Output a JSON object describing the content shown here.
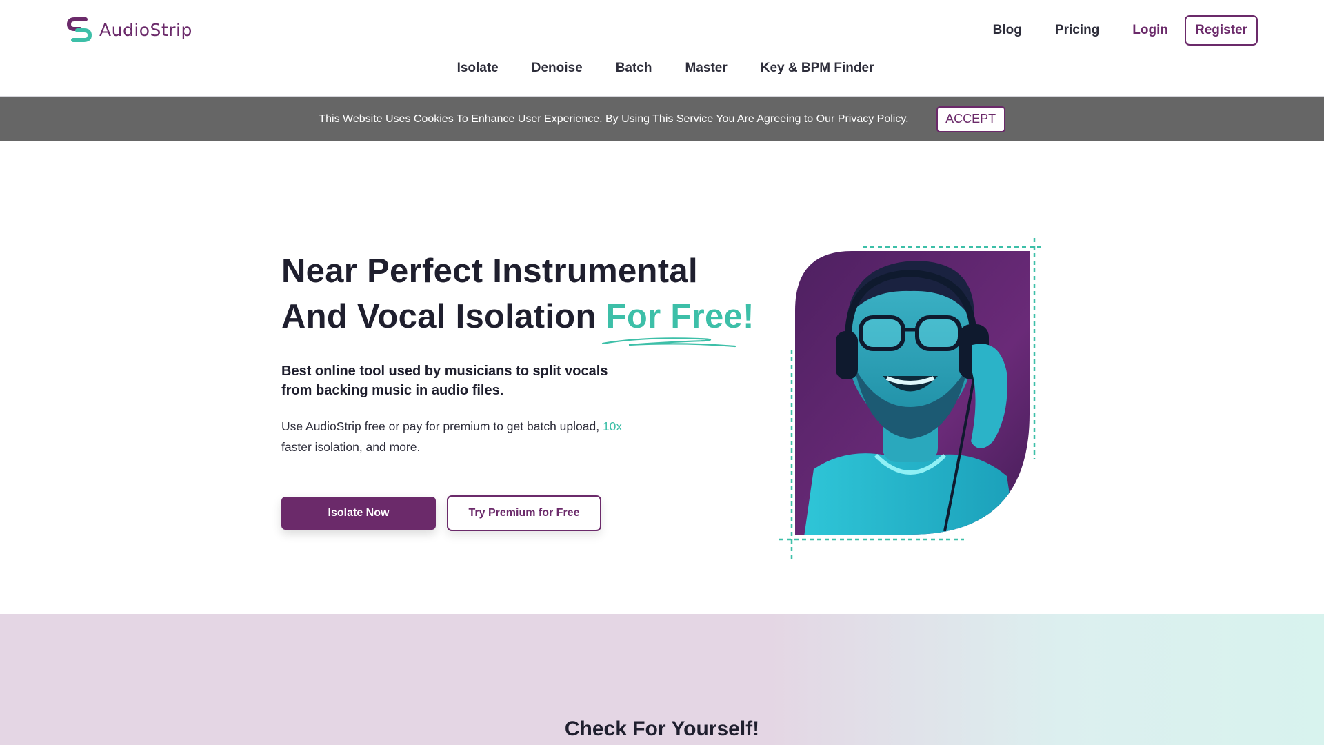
{
  "brand": {
    "name": "AudioStrip",
    "primary_color": "#6b2a6a",
    "accent_color": "#3dbfa8"
  },
  "topnav": {
    "blog": "Blog",
    "pricing": "Pricing",
    "login": "Login",
    "register": "Register"
  },
  "mainnav": {
    "items": [
      "Isolate",
      "Denoise",
      "Batch",
      "Master",
      "Key & BPM Finder"
    ]
  },
  "cookie": {
    "text": "This Website Uses Cookies To Enhance User Experience. By Using This Service You Are Agreeing to Our ",
    "link": "Privacy Policy",
    "end": ".",
    "accept": "ACCEPT"
  },
  "hero": {
    "title_line1": "Near Perfect Instrumental",
    "title_line2": "And Vocal Isolation ",
    "title_accent": "For Free!",
    "subtitle": "Best online tool used by musicians to split vocals from backing music in audio files.",
    "desc_before": "Use AudioStrip free or pay for premium to get batch upload, ",
    "desc_highlight": "10x",
    "desc_after": " faster isolation, and more.",
    "primary_button": "Isolate Now",
    "secondary_button": "Try Premium for Free",
    "image_icon": "man-with-headphones-photo"
  },
  "check": {
    "title": "Check For Yourself!"
  }
}
